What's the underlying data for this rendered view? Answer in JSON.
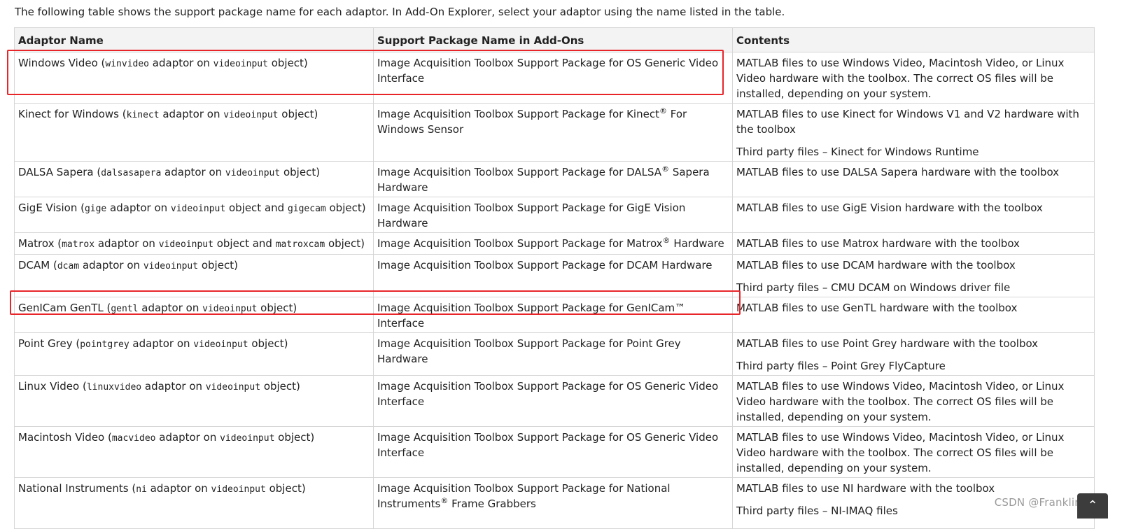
{
  "intro": "The following table shows the support package name for each adaptor. In Add-On Explorer, select your adaptor using the name listed in the table.",
  "headers": [
    "Adaptor Name",
    "Support Package Name in Add-Ons",
    "Contents"
  ],
  "rows": [
    {
      "name": "Windows Video",
      "adaptor": "winvideo",
      "object1": "videoinput",
      "object2": "",
      "package": "Image Acquisition Toolbox Support Package for OS Generic Video Interface",
      "contents": [
        "MATLAB files to use Windows Video, Macintosh Video, or Linux Video hardware with the toolbox. The correct OS files will be installed, depending on your system."
      ]
    },
    {
      "name": "Kinect for Windows",
      "adaptor": "kinect",
      "object1": "videoinput",
      "object2": "",
      "package_before": "Image Acquisition Toolbox Support Package for Kinect",
      "package_after": " For Windows Sensor",
      "contents": [
        "MATLAB files to use Kinect for Windows V1 and V2 hardware with the toolbox",
        "Third party files – Kinect for Windows Runtime"
      ]
    },
    {
      "name": "DALSA Sapera",
      "adaptor": "dalsasapera",
      "object1": "videoinput",
      "object2": "",
      "package_before": "Image Acquisition Toolbox Support Package for DALSA",
      "package_after": " Sapera Hardware",
      "contents": [
        "MATLAB files to use DALSA Sapera hardware with the toolbox"
      ]
    },
    {
      "name": "GigE Vision",
      "adaptor": "gige",
      "object1": "videoinput",
      "object2": "gigecam",
      "package": "Image Acquisition Toolbox Support Package for GigE Vision Hardware",
      "contents": [
        "MATLAB files to use GigE Vision hardware with the toolbox"
      ]
    },
    {
      "name": "Matrox",
      "adaptor": "matrox",
      "object1": "videoinput",
      "object2": "matroxcam",
      "package_before": "Image Acquisition Toolbox Support Package for Matrox",
      "package_after": " Hardware",
      "contents": [
        "MATLAB files to use Matrox hardware with the toolbox"
      ]
    },
    {
      "name": "DCAM",
      "adaptor": "dcam",
      "object1": "videoinput",
      "object2": "",
      "package": "Image Acquisition Toolbox Support Package for DCAM Hardware",
      "contents": [
        "MATLAB files to use DCAM hardware with the toolbox",
        "Third party files – CMU DCAM on Windows driver file"
      ]
    },
    {
      "name": "GenICam GenTL",
      "adaptor": "gentl",
      "object1": "videoinput",
      "object2": "",
      "package": "Image Acquisition Toolbox Support Package for GenICam™ Interface",
      "contents": [
        "MATLAB files to use GenTL hardware with the toolbox"
      ]
    },
    {
      "name": "Point Grey",
      "adaptor": "pointgrey",
      "object1": "videoinput",
      "object2": "",
      "package": "Image Acquisition Toolbox Support Package for Point Grey Hardware",
      "contents": [
        "MATLAB files to use Point Grey hardware with the toolbox",
        "Third party files – Point Grey FlyCapture"
      ]
    },
    {
      "name": "Linux Video",
      "adaptor": "linuxvideo",
      "object1": "videoinput",
      "object2": "",
      "package": "Image Acquisition Toolbox Support Package for OS Generic Video Interface",
      "contents": [
        "MATLAB files to use Windows Video, Macintosh Video, or Linux Video hardware with the toolbox. The correct OS files will be installed, depending on your system."
      ]
    },
    {
      "name": "Macintosh Video",
      "adaptor": "macvideo",
      "object1": "videoinput",
      "object2": "",
      "package": "Image Acquisition Toolbox Support Package for OS Generic Video Interface",
      "contents": [
        "MATLAB files to use Windows Video, Macintosh Video, or Linux Video hardware with the toolbox. The correct OS files will be installed, depending on your system."
      ]
    },
    {
      "name": "National Instruments",
      "adaptor": "ni",
      "object1": "videoinput",
      "object2": "",
      "package_before": "Image Acquisition Toolbox Support Package for National Instruments",
      "package_after": " Frame Grabbers",
      "contents": [
        "MATLAB files to use NI hardware with the toolbox",
        "Third party files – NI-IMAQ files"
      ]
    }
  ],
  "words": {
    "open": " (",
    "adaptor_on": " adaptor on ",
    "object_and": " object and ",
    "object_close": " object)",
    "registered": "®"
  },
  "watermark": "CSDN @Franklin",
  "colors": {
    "highlight": "#e8262a",
    "header_bg": "#f3f3f3",
    "border": "#d6d6d6"
  }
}
